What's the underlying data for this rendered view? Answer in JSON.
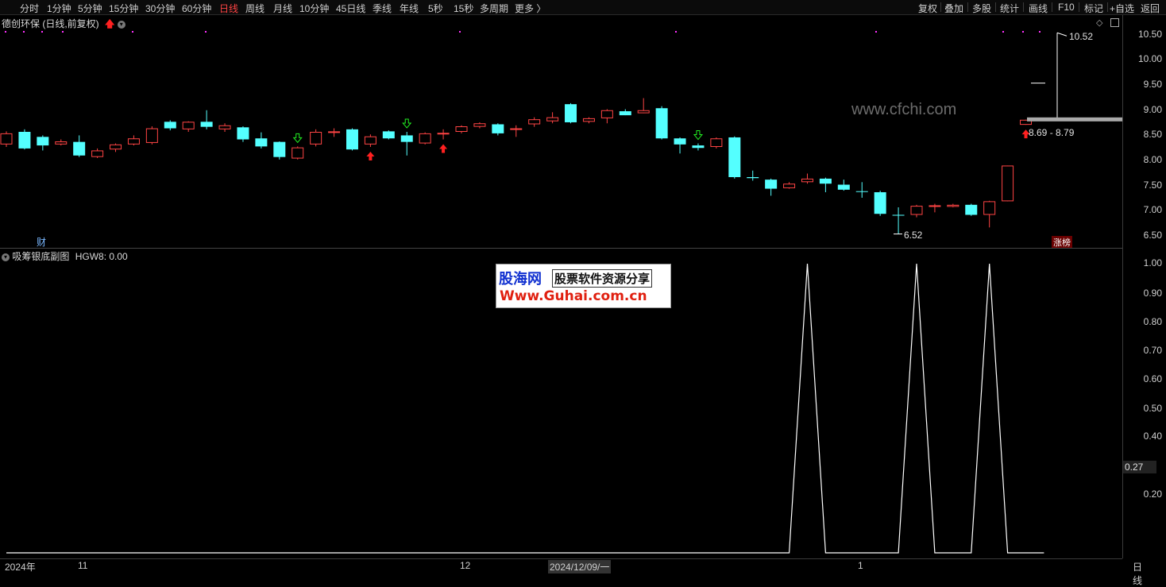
{
  "toolbar": {
    "timeframes": [
      "分时",
      "1分钟",
      "5分钟",
      "15分钟",
      "30分钟",
      "60分钟",
      "日线",
      "周线",
      "月线",
      "10分钟",
      "45日线",
      "季线",
      "年线",
      "5秒",
      "15秒",
      "多周期",
      "更多 〉"
    ],
    "active_timeframe": "日线",
    "right_buttons": [
      "复权",
      "叠加",
      "多股",
      "统计",
      "画线",
      "F10",
      "标记",
      "+自选",
      "返回"
    ]
  },
  "main": {
    "title": "德创环保 (日线,前复权)",
    "price_ticks": [
      "10.50",
      "10.00",
      "9.50",
      "9.00",
      "8.50",
      "8.00",
      "7.50",
      "7.00",
      "6.50"
    ],
    "high_label": "10.52",
    "low_label": "6.52",
    "range_label": "8.69 - 8.79",
    "fin_label": "财",
    "limit_up_label": "涨榜",
    "watermark": "www.cfchi.com"
  },
  "sub": {
    "title": "吸筹银底副图",
    "indicator": "HGW8: 0.00",
    "ticks": [
      "1.00",
      "0.90",
      "0.80",
      "0.70",
      "0.60",
      "0.50",
      "0.40",
      "0.20"
    ],
    "current_value": "0.27"
  },
  "badge": {
    "brand": "股海网",
    "tagline": "股票软件资源分享",
    "url": "Www.Guhai.com.cn"
  },
  "date_axis": {
    "labels": [
      "2024年",
      "11",
      "12",
      "2024/12/09/一",
      "1"
    ],
    "period_label": "日线"
  },
  "colors": {
    "up": "#ff4444",
    "down": "#54ffff",
    "signal_up": "#ff2020",
    "signal_down": "#22ee22",
    "line": "#ffffff"
  },
  "chart_data": {
    "type": "candlestick",
    "ylim": [
      6.4,
      10.6
    ],
    "candles": [
      {
        "o": 8.3,
        "c": 8.52,
        "h": 8.56,
        "l": 8.25
      },
      {
        "o": 8.55,
        "c": 8.22,
        "h": 8.6,
        "l": 8.2
      },
      {
        "o": 8.45,
        "c": 8.28,
        "h": 8.48,
        "l": 8.18
      },
      {
        "o": 8.3,
        "c": 8.36,
        "h": 8.4,
        "l": 8.28
      },
      {
        "o": 8.35,
        "c": 8.08,
        "h": 8.48,
        "l": 8.05
      },
      {
        "o": 8.05,
        "c": 8.18,
        "h": 8.22,
        "l": 8.03
      },
      {
        "o": 8.2,
        "c": 8.3,
        "h": 8.32,
        "l": 8.15
      },
      {
        "o": 8.3,
        "c": 8.42,
        "h": 8.48,
        "l": 8.28
      },
      {
        "o": 8.33,
        "c": 8.62,
        "h": 8.66,
        "l": 8.3
      },
      {
        "o": 8.75,
        "c": 8.62,
        "h": 8.78,
        "l": 8.58
      },
      {
        "o": 8.6,
        "c": 8.75,
        "h": 8.76,
        "l": 8.55
      },
      {
        "o": 8.75,
        "c": 8.65,
        "h": 8.98,
        "l": 8.6
      },
      {
        "o": 8.6,
        "c": 8.68,
        "h": 8.72,
        "l": 8.55
      },
      {
        "o": 8.64,
        "c": 8.4,
        "h": 8.66,
        "l": 8.35
      },
      {
        "o": 8.42,
        "c": 8.26,
        "h": 8.54,
        "l": 8.22
      },
      {
        "o": 8.35,
        "c": 8.05,
        "h": 8.36,
        "l": 8.0
      },
      {
        "o": 8.02,
        "c": 8.24,
        "h": 8.26,
        "l": 8.0
      },
      {
        "o": 8.3,
        "c": 8.55,
        "h": 8.6,
        "l": 8.26
      },
      {
        "o": 8.55,
        "c": 8.56,
        "h": 8.62,
        "l": 8.45
      },
      {
        "o": 8.6,
        "c": 8.2,
        "h": 8.62,
        "l": 8.18
      },
      {
        "o": 8.3,
        "c": 8.46,
        "h": 8.5,
        "l": 8.25
      },
      {
        "o": 8.56,
        "c": 8.42,
        "h": 8.58,
        "l": 8.4
      },
      {
        "o": 8.48,
        "c": 8.35,
        "h": 8.55,
        "l": 8.08
      },
      {
        "o": 8.32,
        "c": 8.52,
        "h": 8.54,
        "l": 8.3
      },
      {
        "o": 8.52,
        "c": 8.53,
        "h": 8.6,
        "l": 8.4
      },
      {
        "o": 8.55,
        "c": 8.66,
        "h": 8.68,
        "l": 8.52
      },
      {
        "o": 8.65,
        "c": 8.72,
        "h": 8.74,
        "l": 8.62
      },
      {
        "o": 8.7,
        "c": 8.52,
        "h": 8.72,
        "l": 8.48
      },
      {
        "o": 8.6,
        "c": 8.62,
        "h": 8.68,
        "l": 8.45
      },
      {
        "o": 8.7,
        "c": 8.8,
        "h": 8.84,
        "l": 8.65
      },
      {
        "o": 8.76,
        "c": 8.84,
        "h": 8.94,
        "l": 8.72
      },
      {
        "o": 9.1,
        "c": 8.74,
        "h": 9.12,
        "l": 8.72
      },
      {
        "o": 8.75,
        "c": 8.82,
        "h": 8.84,
        "l": 8.72
      },
      {
        "o": 8.82,
        "c": 8.98,
        "h": 9.0,
        "l": 8.72
      },
      {
        "o": 8.96,
        "c": 8.88,
        "h": 9.0,
        "l": 8.88
      },
      {
        "o": 8.92,
        "c": 8.98,
        "h": 9.22,
        "l": 8.92
      },
      {
        "o": 9.02,
        "c": 8.42,
        "h": 9.06,
        "l": 8.4
      },
      {
        "o": 8.42,
        "c": 8.3,
        "h": 8.44,
        "l": 8.12
      },
      {
        "o": 8.28,
        "c": 8.23,
        "h": 8.32,
        "l": 8.18
      },
      {
        "o": 8.25,
        "c": 8.42,
        "h": 8.44,
        "l": 8.22
      },
      {
        "o": 8.44,
        "c": 7.65,
        "h": 8.46,
        "l": 7.62
      },
      {
        "o": 7.65,
        "c": 7.63,
        "h": 7.78,
        "l": 7.58
      },
      {
        "o": 7.6,
        "c": 7.42,
        "h": 7.62,
        "l": 7.28
      },
      {
        "o": 7.43,
        "c": 7.52,
        "h": 7.55,
        "l": 7.42
      },
      {
        "o": 7.55,
        "c": 7.62,
        "h": 7.72,
        "l": 7.52
      },
      {
        "o": 7.62,
        "c": 7.52,
        "h": 7.64,
        "l": 7.35
      },
      {
        "o": 7.5,
        "c": 7.4,
        "h": 7.6,
        "l": 7.38
      },
      {
        "o": 7.37,
        "c": 7.36,
        "h": 7.55,
        "l": 7.24
      },
      {
        "o": 7.35,
        "c": 6.92,
        "h": 7.38,
        "l": 6.88
      },
      {
        "o": 6.9,
        "c": 6.89,
        "h": 7.05,
        "l": 6.52
      },
      {
        "o": 6.9,
        "c": 7.08,
        "h": 7.1,
        "l": 6.85
      },
      {
        "o": 7.08,
        "c": 7.09,
        "h": 7.12,
        "l": 6.95
      },
      {
        "o": 7.06,
        "c": 7.1,
        "h": 7.12,
        "l": 7.05
      },
      {
        "o": 7.1,
        "c": 6.9,
        "h": 7.12,
        "l": 6.88
      },
      {
        "o": 6.9,
        "c": 7.17,
        "h": 7.18,
        "l": 6.65
      },
      {
        "o": 7.17,
        "c": 7.88,
        "h": 7.88,
        "l": 7.17
      },
      {
        "o": 8.69,
        "c": 8.79,
        "h": 8.79,
        "l": 8.69
      }
    ],
    "signals_up": [
      20,
      24,
      56
    ],
    "signals_down": [
      16,
      22,
      38
    ],
    "hgw8": [
      0,
      0,
      0,
      0,
      0,
      0,
      0,
      0,
      0,
      0,
      0,
      0,
      0,
      0,
      0,
      0,
      0,
      0,
      0,
      0,
      0,
      0,
      0,
      0,
      0,
      0,
      0,
      0,
      0,
      0,
      0,
      0,
      0,
      0,
      0,
      0,
      0,
      0,
      0,
      0,
      0,
      0,
      0,
      0,
      1,
      0,
      0,
      0,
      0,
      0,
      1,
      0,
      0,
      0,
      1,
      0,
      0,
      0
    ],
    "sub_ylim": [
      0,
      1.0
    ]
  }
}
